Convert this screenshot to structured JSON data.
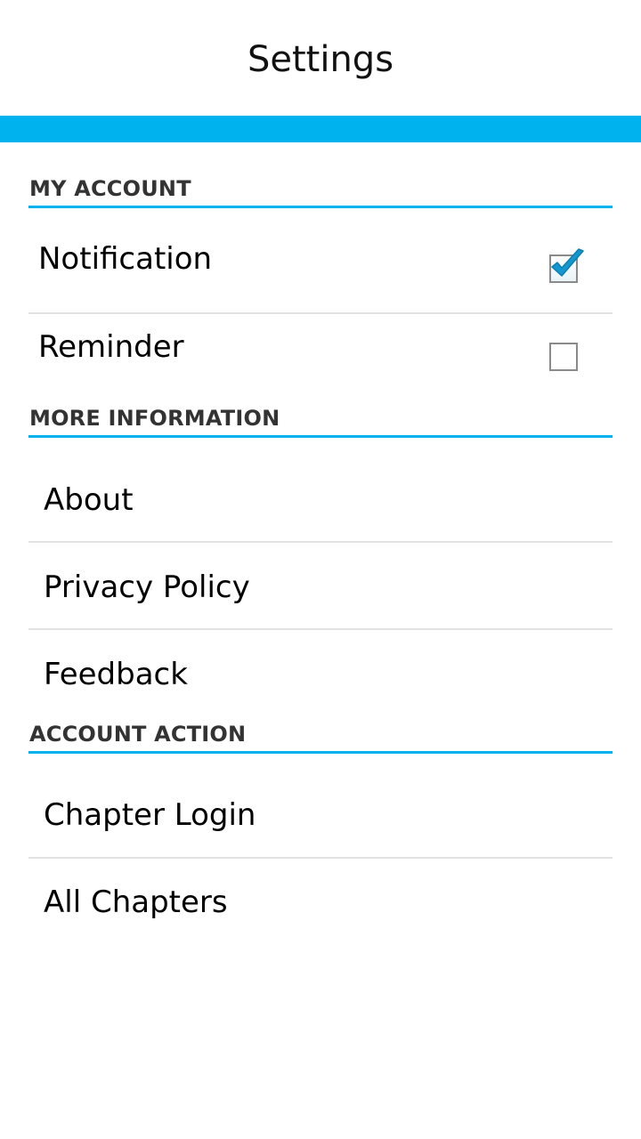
{
  "header": {
    "title": "Settings"
  },
  "colors": {
    "accent": "#00b3ef",
    "divider": "#e2e2e2",
    "section_text": "#333333"
  },
  "sections": {
    "my_account": {
      "title": "MY ACCOUNT",
      "items": [
        {
          "label": "Notification",
          "checked": true,
          "icon": "checkmark-icon"
        },
        {
          "label": "Reminder",
          "checked": false
        }
      ]
    },
    "more_information": {
      "title": "MORE INFORMATION",
      "items": [
        {
          "label": "About"
        },
        {
          "label": "Privacy Policy"
        },
        {
          "label": "Feedback"
        }
      ]
    },
    "account_action": {
      "title": "ACCOUNT ACTION",
      "items": [
        {
          "label": "Chapter Login"
        },
        {
          "label": "All Chapters"
        }
      ]
    }
  }
}
